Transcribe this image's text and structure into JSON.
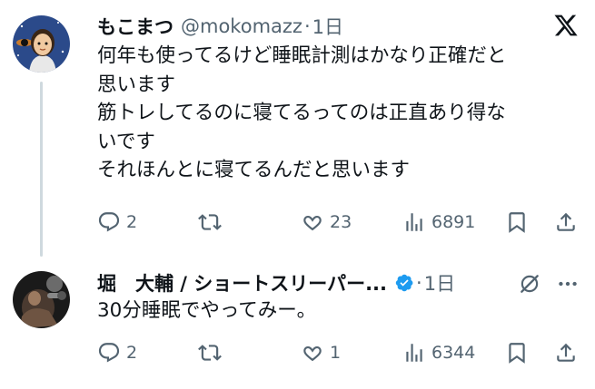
{
  "tweets": [
    {
      "display_name": "もこまつ",
      "handle": "@mokomazz",
      "separator": "·",
      "time": "1日",
      "text_lines": [
        "何年も使ってるけど睡眠計測はかなり正確だと",
        "思います",
        "筋トレしてるのに寝てるってのは正直あり得な",
        "いです",
        "それほんとに寝てるんだと思います"
      ],
      "replies": "2",
      "retweets": "",
      "likes": "23",
      "views": "6891",
      "icons": [
        "x-logo-icon",
        "reply-icon",
        "retweet-icon",
        "like-icon",
        "views-icon",
        "bookmark-icon",
        "share-icon"
      ]
    },
    {
      "display_name": "堀　大輔 / ショートスリーパー...",
      "separator": "·",
      "time": "1日",
      "text_lines": [
        "30分睡眠でやってみー。"
      ],
      "replies": "2",
      "retweets": "",
      "likes": "1",
      "views": "6344",
      "icons": [
        "verified-badge-icon",
        "grok-icon",
        "more-icon",
        "reply-icon",
        "retweet-icon",
        "like-icon",
        "views-icon",
        "bookmark-icon",
        "share-icon"
      ]
    }
  ],
  "colors": {
    "text": "#0f1419",
    "secondary": "#536471",
    "verified": "#1d9bf0",
    "thread_line": "#cfd9de"
  }
}
